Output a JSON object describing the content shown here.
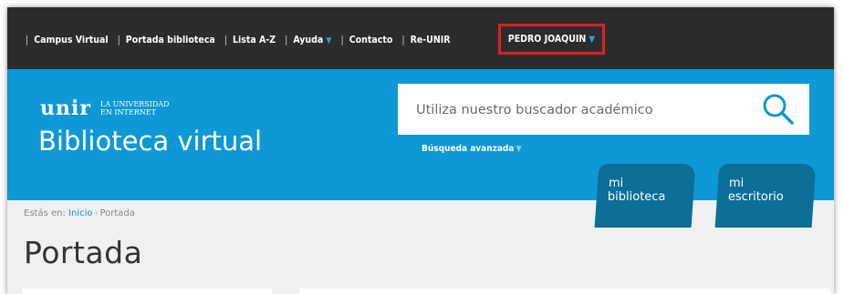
{
  "topnav": {
    "items": [
      {
        "label": "Campus Virtual",
        "has_dropdown": false
      },
      {
        "label": "Portada biblioteca",
        "has_dropdown": false
      },
      {
        "label": "Lista A-Z",
        "has_dropdown": false
      },
      {
        "label": "Ayuda",
        "has_dropdown": true
      },
      {
        "label": "Contacto",
        "has_dropdown": false
      },
      {
        "label": "Re-UNIR",
        "has_dropdown": false
      }
    ],
    "separator": "|",
    "user_name": "PEDRO JOAQUIN",
    "highlight_color": "#e02020"
  },
  "header": {
    "logo_text": "unir",
    "logo_sub_line1": "LA UNIVERSIDAD",
    "logo_sub_line2": "EN INTERNET",
    "site_title": "Biblioteca virtual",
    "brand_color": "#0e98d5"
  },
  "search": {
    "placeholder": "Utiliza nuestro buscador académico",
    "value": "",
    "icon": "search-icon",
    "advanced_label": "Búsqueda avanzada"
  },
  "tabs": [
    {
      "line1": "mi",
      "line2": "biblioteca"
    },
    {
      "line1": "mi",
      "line2": "escritorio"
    }
  ],
  "breadcrumb": {
    "prefix": "Estás en:",
    "link": "Inicio",
    "current": "Portada"
  },
  "page": {
    "title": "Portada"
  }
}
